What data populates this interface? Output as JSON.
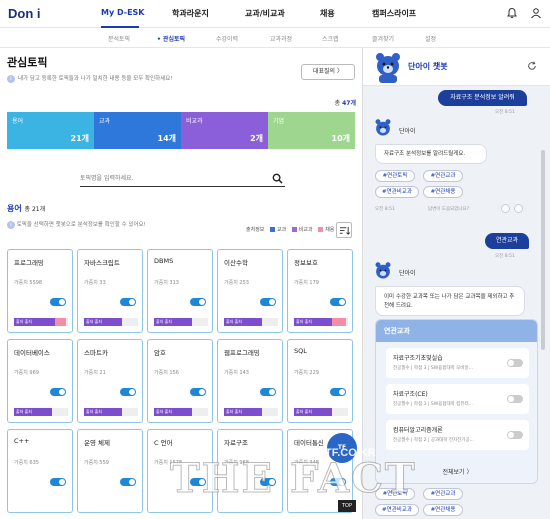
{
  "header": {
    "logo": "Don i",
    "nav": [
      "My D-ESK",
      "학과라운지",
      "교과/비교과",
      "채용",
      "캠퍼스라이프"
    ]
  },
  "subnav": [
    "분석토픽",
    "• 관심토픽",
    "수강이력",
    "교과과정",
    "스크랩",
    "즐겨찾기",
    "설정"
  ],
  "page": {
    "title": "관심토픽",
    "info": "i",
    "description": "내가 담고 등록한 토픽들과 나가 일치한 내용 등을 모두 확인하세요!",
    "rep_question_label": "대표질의",
    "rep_question_arrow": "〉",
    "total_prefix": "총",
    "total_value": "47개"
  },
  "summary": [
    {
      "name": "용어",
      "count": "21개",
      "color": "#3bb3e3"
    },
    {
      "name": "교과",
      "count": "14개",
      "color": "#2f78db"
    },
    {
      "name": "비교과",
      "count": "2개",
      "color": "#8a5fd9"
    },
    {
      "name": "기업",
      "count": "10개",
      "color": "#9fd68f"
    }
  ],
  "search": {
    "placeholder": "토픽명을 입력하세요."
  },
  "terms": {
    "title": "용어",
    "count": "총 21개",
    "desc": "토픽을 선택하면 챗봇으로 분석정보를 확인할 수 있어요!",
    "legend_title": "출처정보",
    "legend": [
      {
        "label": "교과",
        "color": "#3e6fd8"
      },
      {
        "label": "비교과",
        "color": "#9b6ad8"
      },
      {
        "label": "채용",
        "color": "#f090a8"
      }
    ]
  },
  "cards": [
    {
      "name": "프로그래밍",
      "weight": "가중치 5598",
      "fill": 0.75,
      "pink": 0.2,
      "show_bar": true
    },
    {
      "name": "자바스크립트",
      "weight": "가중치 33",
      "fill": 0.7,
      "pink": 0,
      "show_bar": true
    },
    {
      "name": "DBMS",
      "weight": "가중치 313",
      "fill": 0.7,
      "pink": 0,
      "show_bar": true
    },
    {
      "name": "이산수학",
      "weight": "가중치 253",
      "fill": 0.7,
      "pink": 0,
      "show_bar": true
    },
    {
      "name": "정보보호",
      "weight": "가중치 179",
      "fill": 0.7,
      "pink": 0.25,
      "show_bar": true
    },
    {
      "name": "데이터베이스",
      "weight": "가중치 969",
      "fill": 0.7,
      "pink": 0,
      "show_bar": true
    },
    {
      "name": "스마트카",
      "weight": "가중치 21",
      "fill": 0.7,
      "pink": 0,
      "show_bar": true
    },
    {
      "name": "암호",
      "weight": "가중치 156",
      "fill": 0.7,
      "pink": 0,
      "show_bar": true
    },
    {
      "name": "웹프로그래밍",
      "weight": "가중치 143",
      "fill": 0.7,
      "pink": 0,
      "show_bar": true
    },
    {
      "name": "SQL",
      "weight": "가중치 229",
      "fill": 0.7,
      "pink": 0,
      "show_bar": true
    },
    {
      "name": "C++",
      "weight": "가중치 635",
      "fill": 0.7,
      "pink": 0,
      "show_bar": false
    },
    {
      "name": "운영 체제",
      "weight": "가중치 559",
      "fill": 0.7,
      "pink": 0,
      "show_bar": false
    },
    {
      "name": "C 언어",
      "weight": "가중치 1578",
      "fill": 0.7,
      "pink": 0,
      "show_bar": false
    },
    {
      "name": "자료구조",
      "weight": "가중치 968",
      "fill": 0.7,
      "pink": 0,
      "show_bar": false
    },
    {
      "name": "데이터통신",
      "weight": "가중치 348",
      "fill": 0.7,
      "pink": 0,
      "show_bar": false
    }
  ],
  "card_bar_label": "출처 출처",
  "chat": {
    "title": "단아이 챗봇",
    "bot_name": "단아이",
    "user_msg1": "자료구조 분석정보 알려줘",
    "time1": "오전 8:51",
    "bot_msg1": "자료구조 분석정보를 알려드릴게요.",
    "chips": [
      "#연관토픽",
      "#연관교과",
      "#연관비교과",
      "#연관채용"
    ],
    "time2": "오전 8:51",
    "feedback": "답변이 도움되었나요?",
    "user_msg2": "연관교과",
    "time3": "오전 8:51",
    "bot_msg2": "이미 수강한 교과목 또는 나가 담은 교과목을 제외하고 추천해 드려요.",
    "panel_title": "연관교과",
    "panel_items": [
      {
        "name": "자료구조기초및실습",
        "desc": "전공필수 | 학점 3 | SW융합대학 모바일..."
      },
      {
        "name": "자료구조(CE)",
        "desc": "전공필수 | 학점 3 | SW융합대학 컴퓨터..."
      },
      {
        "name": "컴퓨터알고리즘개론",
        "desc": "전공필수 | 학점 2 | 공과대학 전자전기공..."
      }
    ],
    "more": "전체보기 〉",
    "chips2": [
      "#연관토픽",
      "#연관교과",
      "#연관비교과",
      "#연관채용"
    ]
  },
  "watermark": {
    "text": "THE FACT",
    "badge": "TF",
    "site": "TF.CO.KR",
    "top": "TOP"
  }
}
